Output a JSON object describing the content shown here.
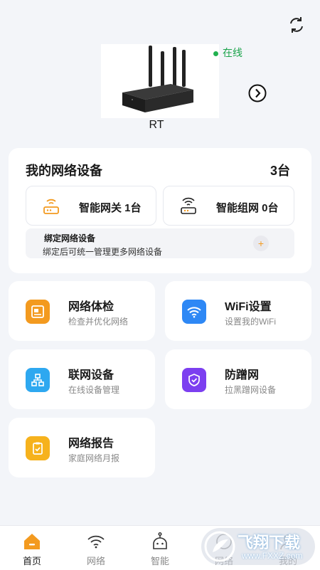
{
  "device": {
    "name": "RT",
    "status": "在线"
  },
  "network": {
    "title": "我的网络设备",
    "count": "3台",
    "gateway_label": "智能网关  1台",
    "mesh_label": "智能组网  0台",
    "bind_title": "绑定网络设备",
    "bind_desc": "绑定后可统一管理更多网络设备",
    "bind_add": "+"
  },
  "features": [
    {
      "title": "网络体检",
      "sub": "检查并优化网络",
      "color": "#f39a1f"
    },
    {
      "title": "WiFi设置",
      "sub": "设置我的WiFi",
      "color": "#2e88f5"
    },
    {
      "title": "联网设备",
      "sub": "在线设备管理",
      "color": "#2ea8f0"
    },
    {
      "title": "防蹭网",
      "sub": "拉黑蹭网设备",
      "color": "#7c3ff0"
    },
    {
      "title": "网络报告",
      "sub": "家庭网络月报",
      "color": "#f6b21d"
    }
  ],
  "tabs": [
    {
      "label": "首页",
      "active": true
    },
    {
      "label": "网络"
    },
    {
      "label": "智能"
    },
    {
      "label": "网络"
    },
    {
      "label": "我的"
    }
  ],
  "watermark": {
    "title": "飞翔下载",
    "url": "www.FXXZ.com"
  },
  "colors": {
    "accent": "#f39a1f",
    "online": "#1aa34a",
    "background": "#f3f5f9"
  }
}
